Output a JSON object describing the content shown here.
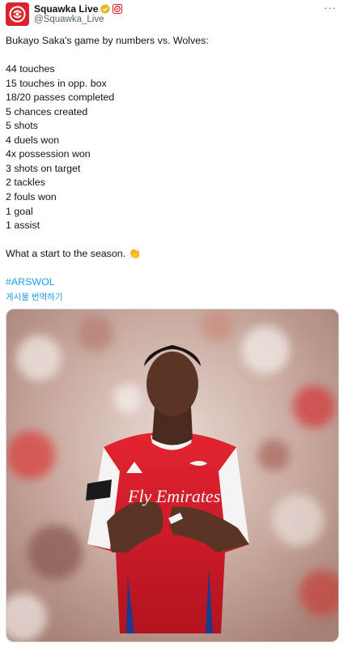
{
  "author": {
    "display_name": "Squawka Live",
    "handle": "@Squawka_Live",
    "avatar_icon": "squawka-logo-icon",
    "verified_icon": "gold-verified-badge-icon",
    "affiliate_icon": "affiliate-badge-icon",
    "brand_color": "#d9232d"
  },
  "more_label": "···",
  "tweet": {
    "intro": "Bukayo Saka's game by numbers vs. Wolves:",
    "stats": [
      "44 touches",
      "15 touches in opp. box",
      "18/20 passes completed",
      "5 chances created",
      "5 shots",
      "4 duels won",
      "4x possession won",
      "3 shots on target",
      "2 tackles",
      "2 fouls won",
      "1 goal",
      "1 assist"
    ],
    "closing": "What a start to the season. 👏",
    "hashtag": "#ARSWOL",
    "translate_label": "게시물 번역하기"
  },
  "media": {
    "kit_sponsor": "Fly Emirates",
    "colors": {
      "shirt_red": "#db1f2a",
      "sleeve_white": "#f4f4f4",
      "link_blue": "#1d9bf0"
    }
  }
}
